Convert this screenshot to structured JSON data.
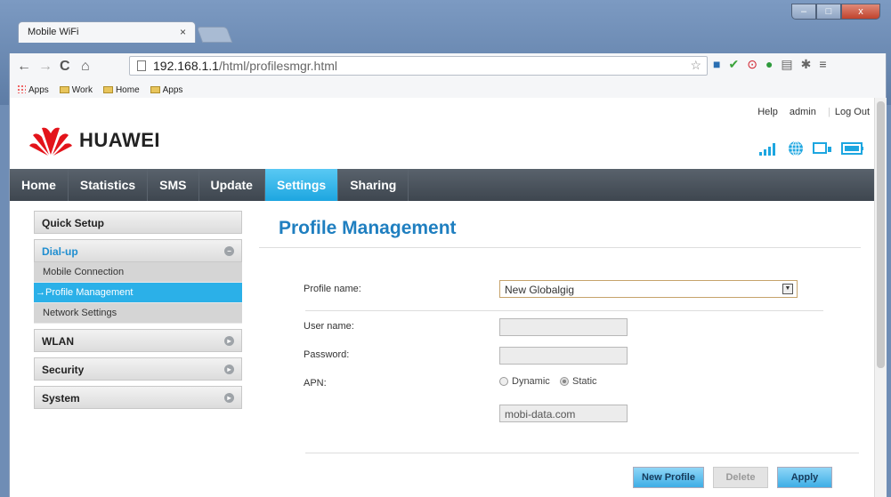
{
  "browser": {
    "tab_title": "Mobile WiFi",
    "tab_close": "×",
    "url_host": "192.168.1.1",
    "url_path": "/html/profilesmgr.html",
    "bookmarks": [
      "Apps",
      "Work",
      "Home",
      "Apps"
    ],
    "window_buttons": {
      "minimize": "–",
      "maximize": "□",
      "close": "x"
    }
  },
  "header": {
    "brand": "HUAWEI",
    "links": [
      "Help",
      "admin",
      "Log Out"
    ]
  },
  "nav": {
    "items": [
      "Home",
      "Statistics",
      "SMS",
      "Update",
      "Settings",
      "Sharing"
    ],
    "active": "Settings"
  },
  "sidebar": {
    "quick_setup": "Quick Setup",
    "dialup": "Dial-up",
    "sub": [
      "Mobile Connection",
      "→Profile Management",
      "Network Settings"
    ],
    "wlan": "WLAN",
    "security": "Security",
    "system": "System"
  },
  "content": {
    "title": "Profile Management",
    "profile_label": "Profile name:",
    "profile_value": "New Globalgig",
    "user_label": "User name:",
    "password_label": "Password:",
    "apn_label": "APN:",
    "apn_dynamic": "Dynamic",
    "apn_static": "Static",
    "apn_value": "mobi-data.com",
    "btn_new": "New Profile",
    "btn_delete": "Delete",
    "btn_apply": "Apply"
  },
  "colors": {
    "accent": "#1da6e0",
    "title": "#1f7fc0",
    "nav_bg": "#3e464f",
    "brand_red": "#e3131a"
  }
}
